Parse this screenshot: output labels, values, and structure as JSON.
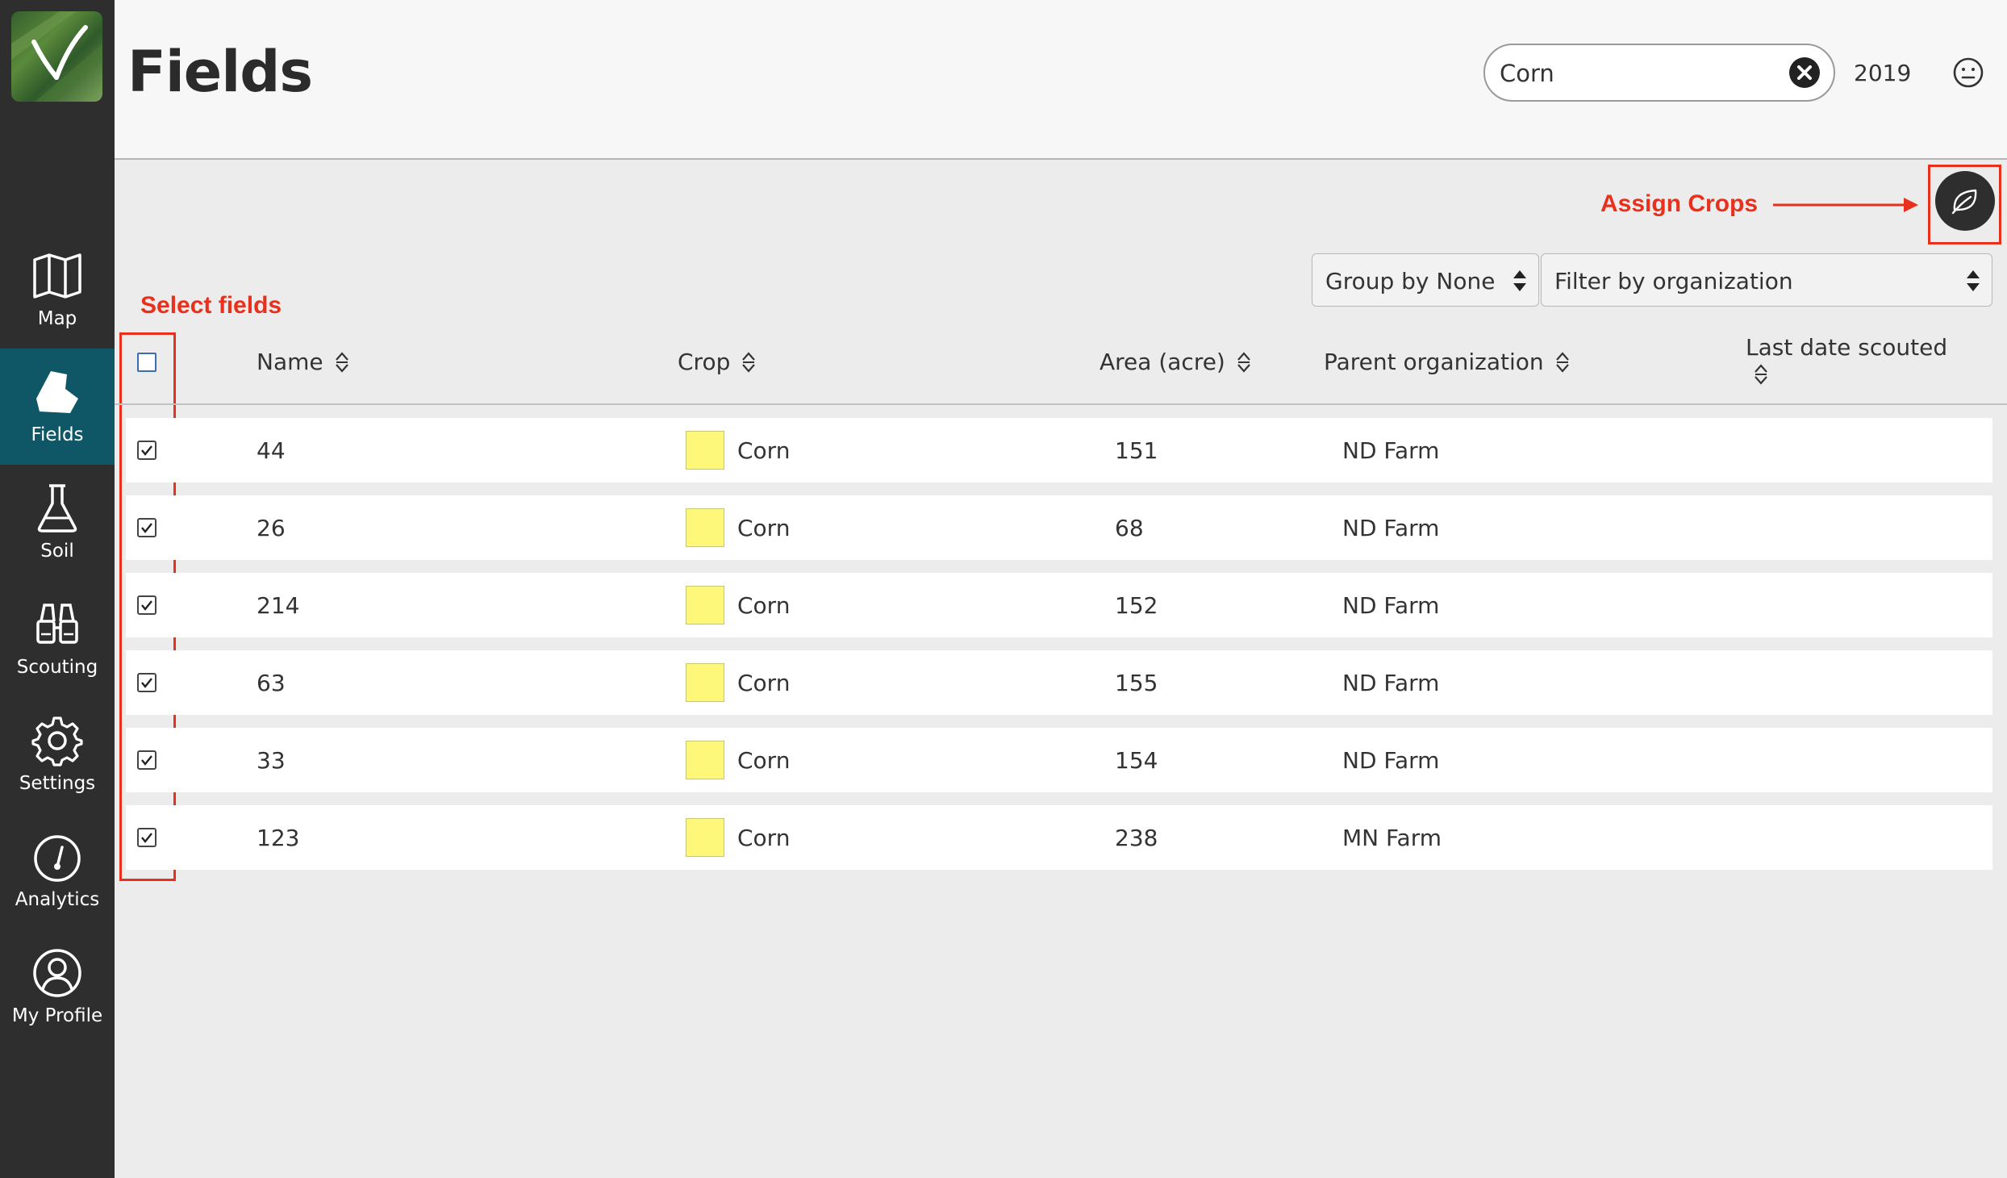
{
  "app": {
    "page_title": "Fields"
  },
  "nav": {
    "items": [
      {
        "label": "Map",
        "icon": "map-icon"
      },
      {
        "label": "Fields",
        "icon": "field-shape-icon",
        "active": true
      },
      {
        "label": "Soil",
        "icon": "flask-icon"
      },
      {
        "label": "Scouting",
        "icon": "binoculars-icon"
      },
      {
        "label": "Settings",
        "icon": "gear-icon"
      },
      {
        "label": "Analytics",
        "icon": "gauge-icon"
      },
      {
        "label": "My Profile",
        "icon": "user-icon"
      }
    ]
  },
  "header": {
    "search_value": "Corn",
    "year": "2019"
  },
  "annotations": {
    "assign_crops": "Assign Crops",
    "select_fields": "Select fields"
  },
  "controls": {
    "group_by": "Group by None",
    "filter_by": "Filter by organization"
  },
  "table": {
    "columns": {
      "name": "Name",
      "crop": "Crop",
      "area": "Area (acre)",
      "parent": "Parent organization",
      "last_scouted": "Last date scouted"
    },
    "rows": [
      {
        "name": "44",
        "crop": "Corn",
        "area": "151",
        "parent": "ND Farm",
        "checked": true
      },
      {
        "name": "26",
        "crop": "Corn",
        "area": "68",
        "parent": "ND Farm",
        "checked": true
      },
      {
        "name": "214",
        "crop": "Corn",
        "area": "152",
        "parent": "ND Farm",
        "checked": true
      },
      {
        "name": "63",
        "crop": "Corn",
        "area": "155",
        "parent": "ND Farm",
        "checked": true
      },
      {
        "name": "33",
        "crop": "Corn",
        "area": "154",
        "parent": "ND Farm",
        "checked": true
      },
      {
        "name": "123",
        "crop": "Corn",
        "area": "238",
        "parent": "MN Farm",
        "checked": true
      }
    ]
  },
  "colors": {
    "sidebar": "#2e2e2e",
    "active_nav": "#0f5666",
    "crop_corn": "#fdf87a",
    "annotation": "#e8301c"
  }
}
